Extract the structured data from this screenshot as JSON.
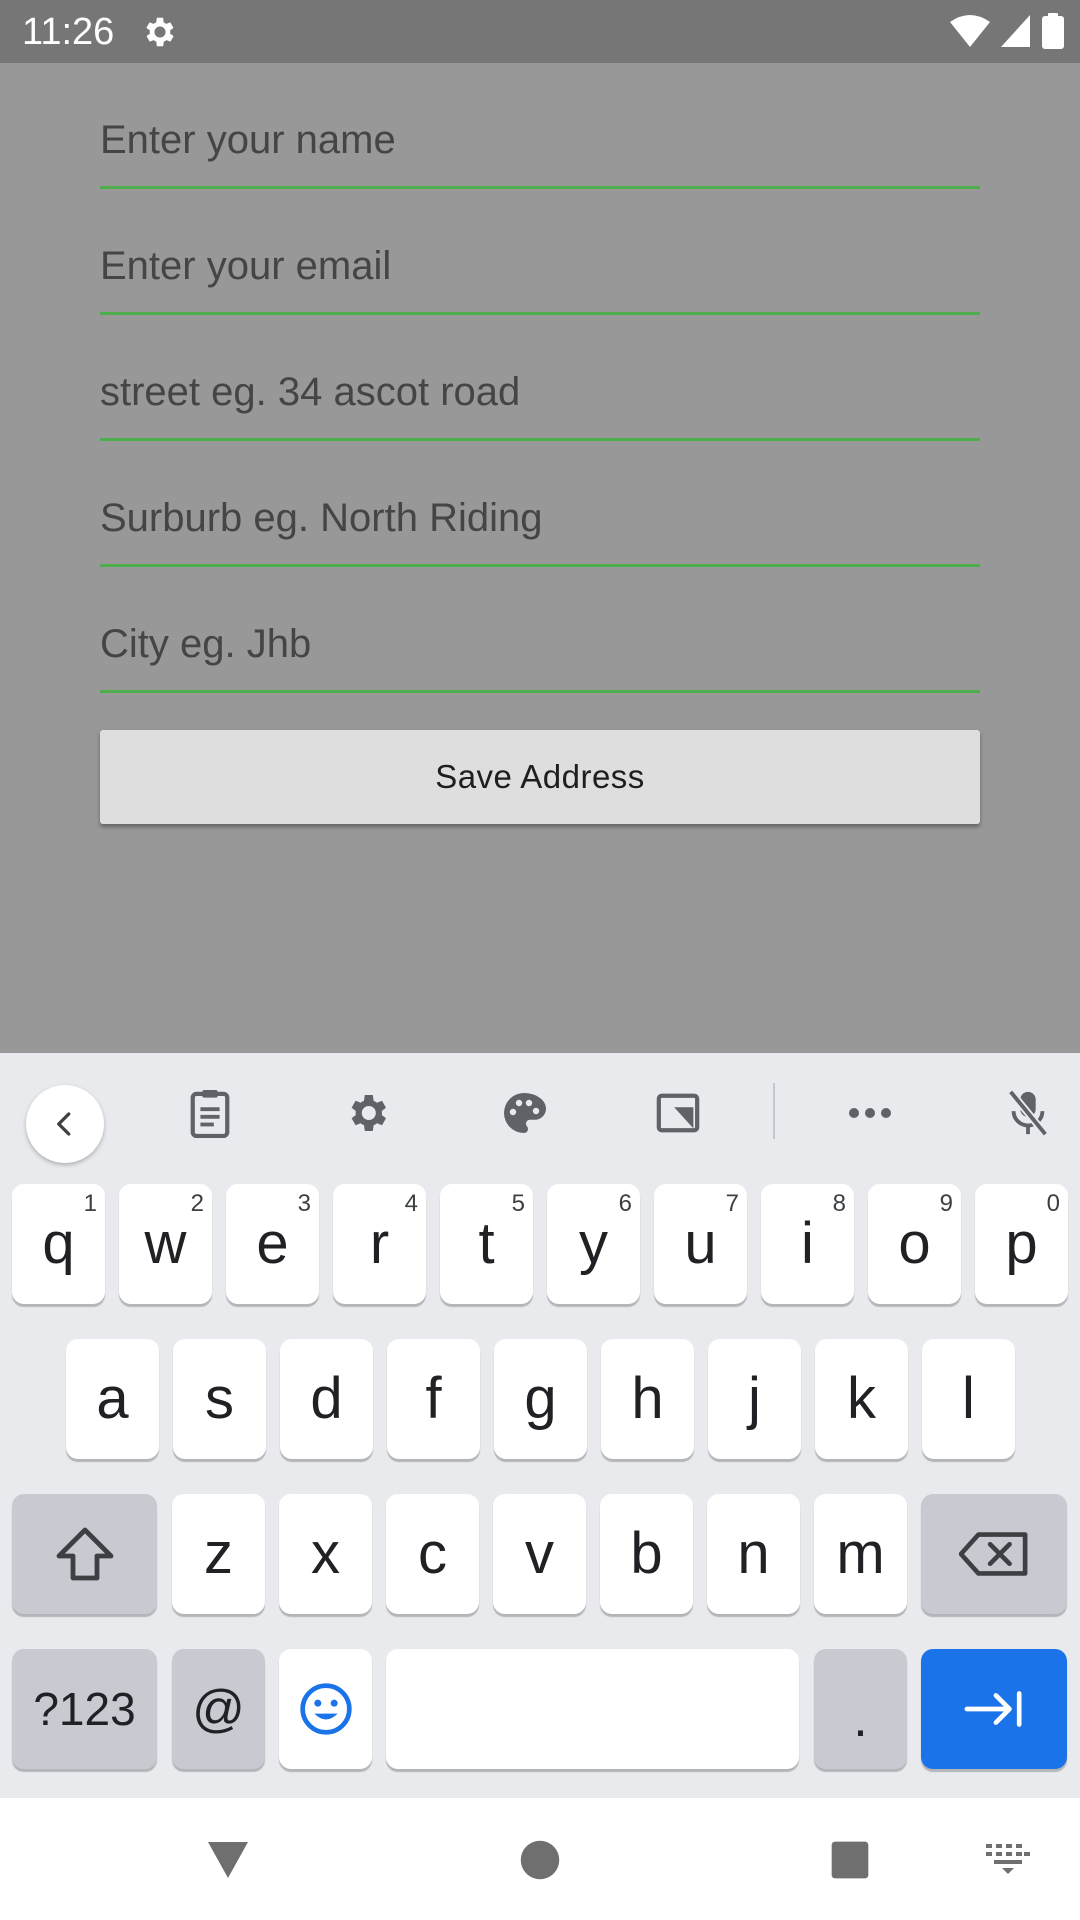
{
  "status_bar": {
    "time": "11:26",
    "icons": [
      "settings-gear-icon",
      "wifi-icon",
      "cellular-signal-icon",
      "battery-icon"
    ]
  },
  "form": {
    "name_placeholder": "Enter your name",
    "email_placeholder": "Enter your email",
    "street_placeholder": "street eg. 34 ascot road",
    "suburb_placeholder": "Surburb eg. North Riding",
    "city_placeholder": "City eg. Jhb",
    "save_label": "Save Address",
    "accent_color": "#4cae4c"
  },
  "keyboard": {
    "toolbar_icons": [
      "chevron-left-icon",
      "clipboard-icon",
      "settings-icon",
      "palette-icon",
      "resize-icon",
      "more-icon",
      "mic-off-icon"
    ],
    "row1": [
      {
        "letter": "q",
        "hint": "1"
      },
      {
        "letter": "w",
        "hint": "2"
      },
      {
        "letter": "e",
        "hint": "3"
      },
      {
        "letter": "r",
        "hint": "4"
      },
      {
        "letter": "t",
        "hint": "5"
      },
      {
        "letter": "y",
        "hint": "6"
      },
      {
        "letter": "u",
        "hint": "7"
      },
      {
        "letter": "i",
        "hint": "8"
      },
      {
        "letter": "o",
        "hint": "9"
      },
      {
        "letter": "p",
        "hint": "0"
      }
    ],
    "row2": [
      "a",
      "s",
      "d",
      "f",
      "g",
      "h",
      "j",
      "k",
      "l"
    ],
    "row3": [
      "z",
      "x",
      "c",
      "v",
      "b",
      "n",
      "m"
    ],
    "symbols_label": "?123",
    "at_label": "@",
    "period_label": ".",
    "action_color": "#1a73e8"
  },
  "nav_bar": {
    "icons": [
      "back-icon",
      "home-icon",
      "recents-icon",
      "keyboard-switch-icon"
    ]
  }
}
